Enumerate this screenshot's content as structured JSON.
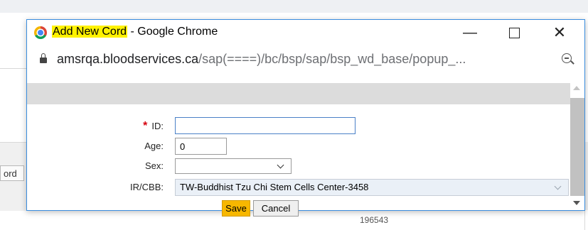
{
  "background": {
    "tab_fragment": "ord",
    "number_fragment": "196543"
  },
  "window": {
    "title_highlight": "Add New Cord",
    "title_rest": " - Google Chrome",
    "controls": {
      "minimize": "—",
      "close": "✕"
    }
  },
  "address": {
    "host": "amsrqa.bloodservices.ca",
    "path": "/sap(====)/bc/bsp/sap/bsp_wd_base/popup_..."
  },
  "form": {
    "id_label": "ID:",
    "required_mark": "*",
    "id_value": "",
    "age_label": "Age:",
    "age_value": "0",
    "sex_label": "Sex:",
    "sex_value": "",
    "ircbb_label": "IR/CBB:",
    "ircbb_value": "TW-Buddhist Tzu Chi Stem Cells Center-3458",
    "save_label": "Save",
    "cancel_label": "Cancel"
  },
  "colors": {
    "title_highlight": "#fff200",
    "save_button": "#f7b700",
    "window_border": "#3a8dde",
    "required": "#d6000e"
  },
  "icons": [
    "chrome-icon",
    "lock-icon",
    "zoom-icon",
    "chevron-down-icon"
  ]
}
